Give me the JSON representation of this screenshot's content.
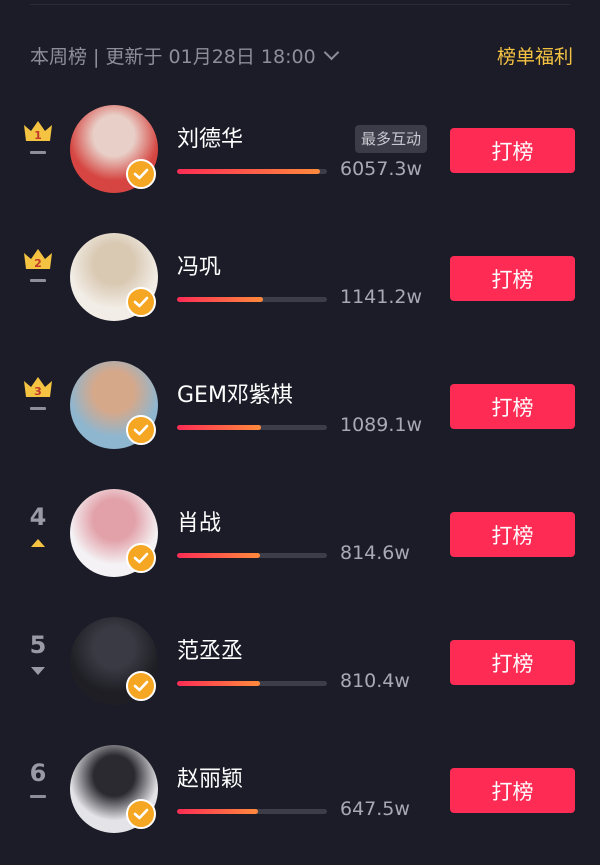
{
  "header": {
    "period_text": "本周榜 | 更新于 01月28日 18:00",
    "benefit_link": "榜单福利"
  },
  "colors": {
    "background": "#1c1c28",
    "accent_red": "#fe2c55",
    "gold": "#f5c342",
    "verify_badge": "#f5a623"
  },
  "ranking": [
    {
      "rank": "1",
      "name": "刘德华",
      "score": "6057.3w",
      "tag": "最多互动",
      "trend": "same",
      "progress": 0.95,
      "button": "打榜",
      "avatar_colors": [
        "#d64541",
        "#e8d0c8"
      ]
    },
    {
      "rank": "2",
      "name": "冯巩",
      "score": "1141.2w",
      "tag": "",
      "trend": "same",
      "progress": 0.57,
      "button": "打榜",
      "avatar_colors": [
        "#f2ede6",
        "#d9c9b3"
      ]
    },
    {
      "rank": "3",
      "name": "GEM邓紫棋",
      "score": "1089.1w",
      "tag": "",
      "trend": "same",
      "progress": 0.56,
      "button": "打榜",
      "avatar_colors": [
        "#8fb6cf",
        "#d6a88a"
      ]
    },
    {
      "rank": "4",
      "name": "肖战",
      "score": "814.6w",
      "tag": "",
      "trend": "up",
      "progress": 0.55,
      "button": "打榜",
      "avatar_colors": [
        "#f4f2f4",
        "#e2a0a8"
      ]
    },
    {
      "rank": "5",
      "name": "范丞丞",
      "score": "810.4w",
      "tag": "",
      "trend": "down",
      "progress": 0.55,
      "button": "打榜",
      "avatar_colors": [
        "#1e1e24",
        "#3a3a44"
      ]
    },
    {
      "rank": "6",
      "name": "赵丽颖",
      "score": "647.5w",
      "tag": "",
      "trend": "same",
      "progress": 0.54,
      "button": "打榜",
      "avatar_colors": [
        "#e4e4e8",
        "#2a2a30"
      ]
    }
  ]
}
